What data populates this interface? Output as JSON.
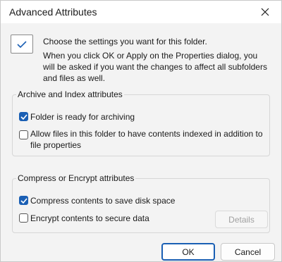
{
  "window": {
    "title": "Advanced Attributes",
    "close_icon": "close-icon"
  },
  "intro": {
    "icon": "checkmark-icon",
    "line1": "Choose the settings you want for this folder.",
    "line2": "When you click OK or Apply on the Properties dialog, you will be asked if you want the changes to affect all subfolders and files as well."
  },
  "archive_group": {
    "label": "Archive and Index attributes",
    "options": [
      {
        "label": "Folder is ready for archiving",
        "checked": true
      },
      {
        "label": "Allow files in this folder to have contents indexed in addition to file properties",
        "checked": false
      }
    ]
  },
  "compress_group": {
    "label": "Compress or Encrypt attributes",
    "options": [
      {
        "label": "Compress contents to save disk space",
        "checked": true
      },
      {
        "label": "Encrypt contents to secure data",
        "checked": false
      }
    ],
    "details_label": "Details"
  },
  "buttons": {
    "ok_label": "OK",
    "cancel_label": "Cancel"
  },
  "colors": {
    "accent": "#1a5fb4",
    "window_bg": "#f3f3f3"
  }
}
